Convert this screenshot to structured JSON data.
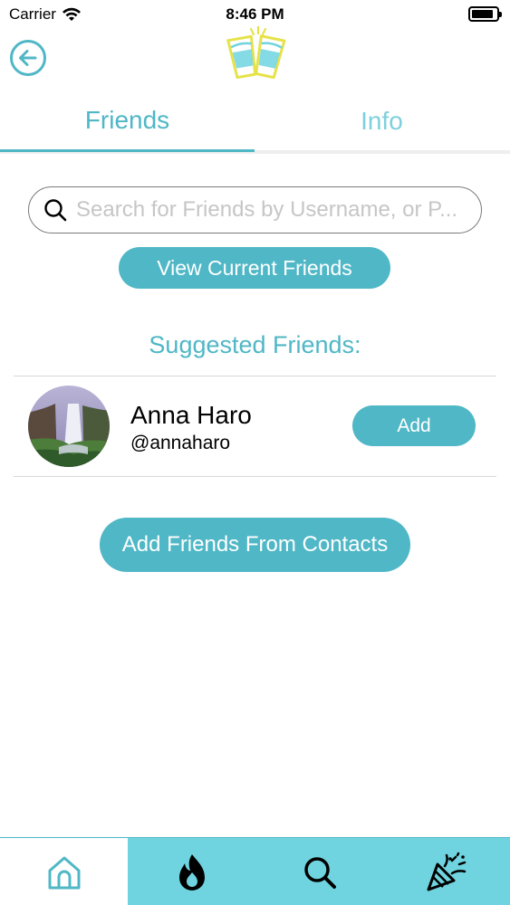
{
  "status_bar": {
    "carrier": "Carrier",
    "time": "8:46 PM",
    "battery_level": 0.9
  },
  "header": {
    "back_icon": "arrow-left-circle-icon",
    "logo_icon": "cheers-glasses-logo"
  },
  "tabs": [
    {
      "label": "Friends",
      "active": true
    },
    {
      "label": "Info",
      "active": false
    }
  ],
  "search": {
    "placeholder": "Search for Friends by Username, or P...",
    "value": ""
  },
  "buttons": {
    "view_current": "View Current Friends",
    "add_from_contacts": "Add Friends From Contacts"
  },
  "suggested": {
    "title": "Suggested Friends:",
    "friends": [
      {
        "name": "Anna Haro",
        "handle": "@annaharo",
        "add_label": "Add"
      }
    ]
  },
  "tabbar": {
    "items": [
      {
        "icon": "home-icon",
        "active": true
      },
      {
        "icon": "fire-icon",
        "active": false
      },
      {
        "icon": "search-icon",
        "active": false
      },
      {
        "icon": "party-popper-icon",
        "active": false
      }
    ]
  },
  "colors": {
    "accent": "#4fb7c6",
    "accent_light": "#7fd0dc",
    "tabbar_bg": "#6fd4e0",
    "logo_yellow": "#e6e24a",
    "logo_cyan": "#6fd4e0"
  }
}
